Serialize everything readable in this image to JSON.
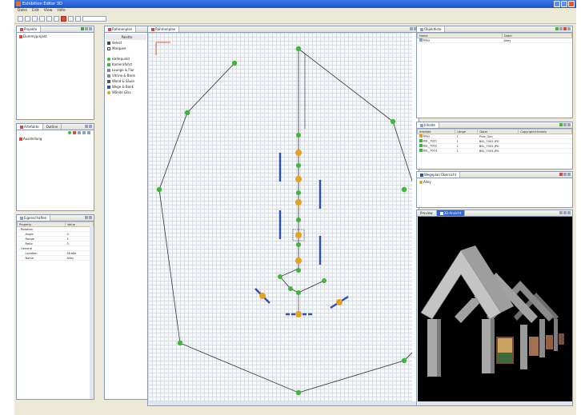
{
  "window": {
    "title": "Exhibition Editor 3D"
  },
  "menu": [
    "Datei",
    "Edit",
    "View",
    "Hilfe"
  ],
  "toolbar": {
    "buttons": [
      "new-icon",
      "open-icon",
      "save-icon",
      "cut-icon",
      "copy-icon",
      "paste-icon",
      "delete-icon",
      "undo-icon",
      "redo-icon"
    ]
  },
  "panels": {
    "projects": {
      "tab": "Projekte",
      "tree_root": "Dummyprojekt"
    },
    "outline": {
      "tabs": [
        "Artefakte",
        "Outline"
      ],
      "tree_root": "Ausstellung"
    },
    "properties": {
      "tab": "Eigenschaften",
      "columns": [
        "Property",
        "Value"
      ],
      "rows": [
        {
          "prop": "- Rotation",
          "value": ""
        },
        {
          "prop": "Angle",
          "value": "0"
        },
        {
          "prop": "Range",
          "value": "1"
        },
        {
          "prop": "Ratio",
          "value": "0"
        },
        {
          "prop": "- General",
          "value": ""
        },
        {
          "prop": "Location",
          "value": "Straße"
        },
        {
          "prop": "Name",
          "value": "Alley"
        }
      ]
    },
    "palette": {
      "title": "Rahmenplan",
      "header": "Palette",
      "items": [
        "Select",
        "Marquee",
        "Haltepunkt",
        "Kamerafahrt",
        "Lounge & Flur",
        "Vitrine & Bank",
        "Wand & Säule",
        "Wege & Bank",
        "Wände Glas"
      ]
    },
    "editor": {
      "tab": "Rahmenplan"
    },
    "objects": {
      "tab": "Objektliste",
      "columns": [
        "Name",
        "Datei"
      ],
      "rows": [
        {
          "name": "Alley",
          "file": "Alley"
        }
      ]
    },
    "contents": {
      "tab": "Inhalte",
      "columns": [
        "Artefakt",
        "Länge",
        "Datei",
        "Copyright/Hinweis"
      ],
      "rows": [
        {
          "name": "Alley",
          "len": "1",
          "file": "Proe_Gen",
          "note": ""
        },
        {
          "name": "BSL_7001",
          "len": "1",
          "file": "BSL_7001.JPG",
          "note": ""
        },
        {
          "name": "BSL_7002",
          "len": "1",
          "file": "BSL_7002.JPG",
          "note": ""
        },
        {
          "name": "BSL_7003",
          "len": "1",
          "file": "BSL_7003.JPG",
          "note": ""
        }
      ]
    },
    "outline_right": {
      "tab": "Wegeplan Übersicht",
      "item": "Alley"
    },
    "preview": {
      "tabs": [
        "Preview",
        "3D-Ansicht"
      ]
    }
  },
  "colors": {
    "titlebar": "#2f67d8",
    "node_green": "#3fb53a",
    "node_orange": "#e8a020",
    "wall_blue": "#2a4fc0",
    "panel_border": "#8a9ab8"
  }
}
